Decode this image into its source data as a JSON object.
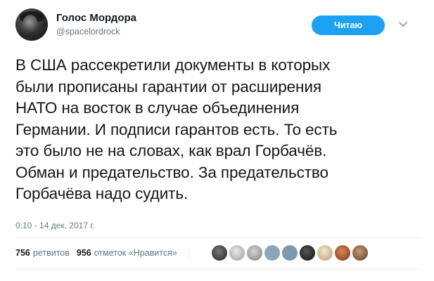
{
  "author": {
    "name": "Голос Мордора",
    "handle": "@spacelordrock",
    "avatar_icon": "avatar-icon"
  },
  "header": {
    "follow_button_label": "Читаю",
    "menu_icon": "chevron-down-icon"
  },
  "tweet": {
    "text": "В США рассекретили документы в которых\nбыли прописаны гарантии от расширения\nНАТО на восток в случае объединения\nГермании. И подписи гарантов есть. То есть\nэто было не на словах, как врал Горбачёв.\nОбман и предательство. За предательство\nГорбачёва надо судить.",
    "timestamp": "0:10 - 14 дек. 2017 г."
  },
  "stats": {
    "retweets_count": "756",
    "retweets_label": "ретвитов",
    "likes_count": "956",
    "likes_label": "отметок «Нравится»"
  },
  "colors": {
    "accent": "#1da1f2",
    "text_primary": "#14171a",
    "text_secondary": "#657786",
    "divider": "#e6ecf0"
  }
}
